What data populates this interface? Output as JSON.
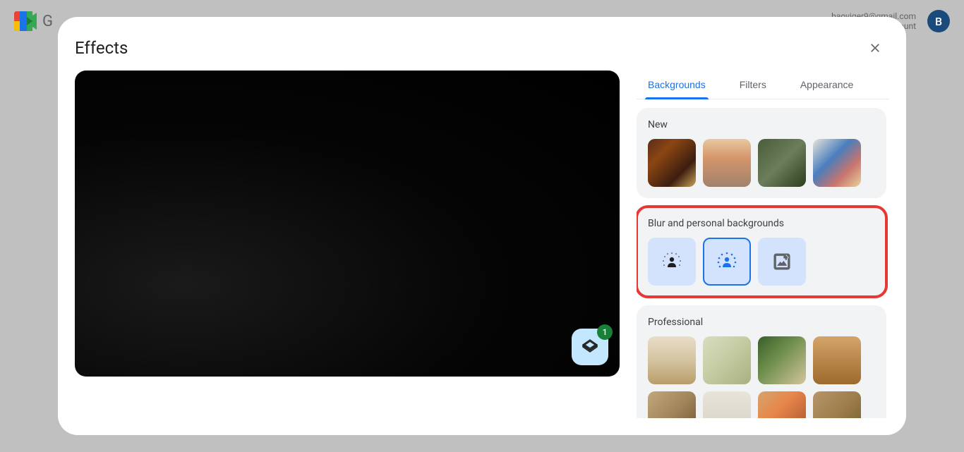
{
  "header": {
    "email": "baoviger9@gmail.com",
    "account_label": "ount",
    "avatar_letter": "B"
  },
  "modal": {
    "title": "Effects"
  },
  "tabs": {
    "backgrounds": "Backgrounds",
    "filters": "Filters",
    "appearance": "Appearance"
  },
  "sections": {
    "new": "New",
    "blur": "Blur and personal backgrounds",
    "professional": "Professional"
  },
  "effects_badge_count": "1",
  "icons": {
    "close": "close-icon",
    "layers": "layers-icon",
    "blur_light": "blur-light-icon",
    "blur_strong": "blur-strong-icon",
    "upload": "upload-image-icon"
  }
}
